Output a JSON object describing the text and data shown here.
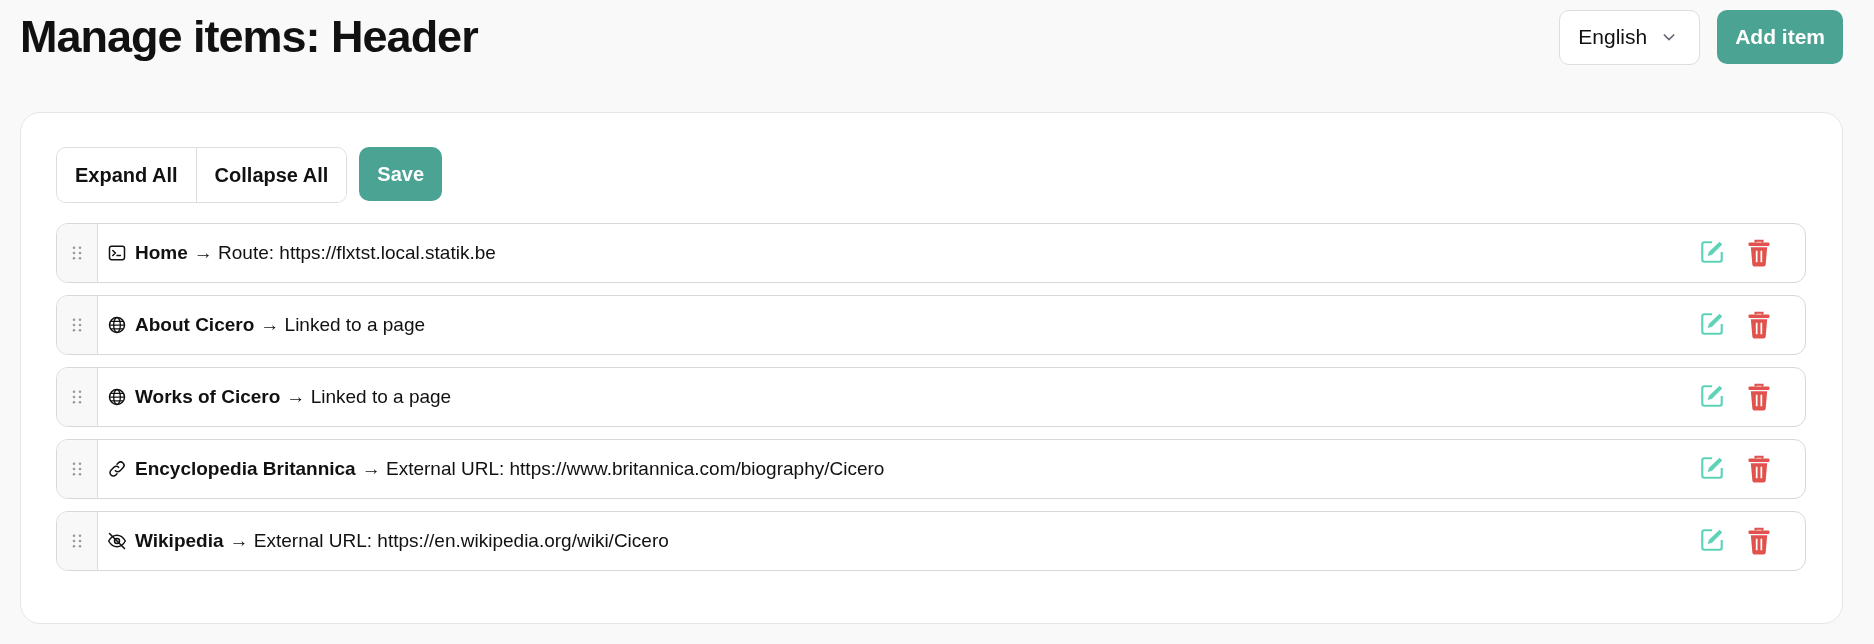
{
  "page": {
    "title": "Manage items: Header"
  },
  "language_select": {
    "value": "English"
  },
  "add_button": "Add item",
  "toolbar": {
    "buttons": [
      "Expand All",
      "Collapse All"
    ],
    "save": "Save"
  },
  "items": [
    {
      "kind": "route",
      "label": "Home",
      "target": "→ Route: https://flxtst.local.statik.be"
    },
    {
      "kind": "page",
      "label": "About Cicero",
      "target": "→ Linked to a page"
    },
    {
      "kind": "page",
      "label": "Works of Cicero",
      "target": "→ Linked to a page"
    },
    {
      "kind": "link",
      "label": "Encyclopedia Britannica",
      "target": "→ External URL: https://www.britannica.com/biography/Cicero"
    },
    {
      "kind": "hidden",
      "label": "Wikipedia",
      "target": "→ External URL: https://en.wikipedia.org/wiki/Cicero"
    }
  ]
}
